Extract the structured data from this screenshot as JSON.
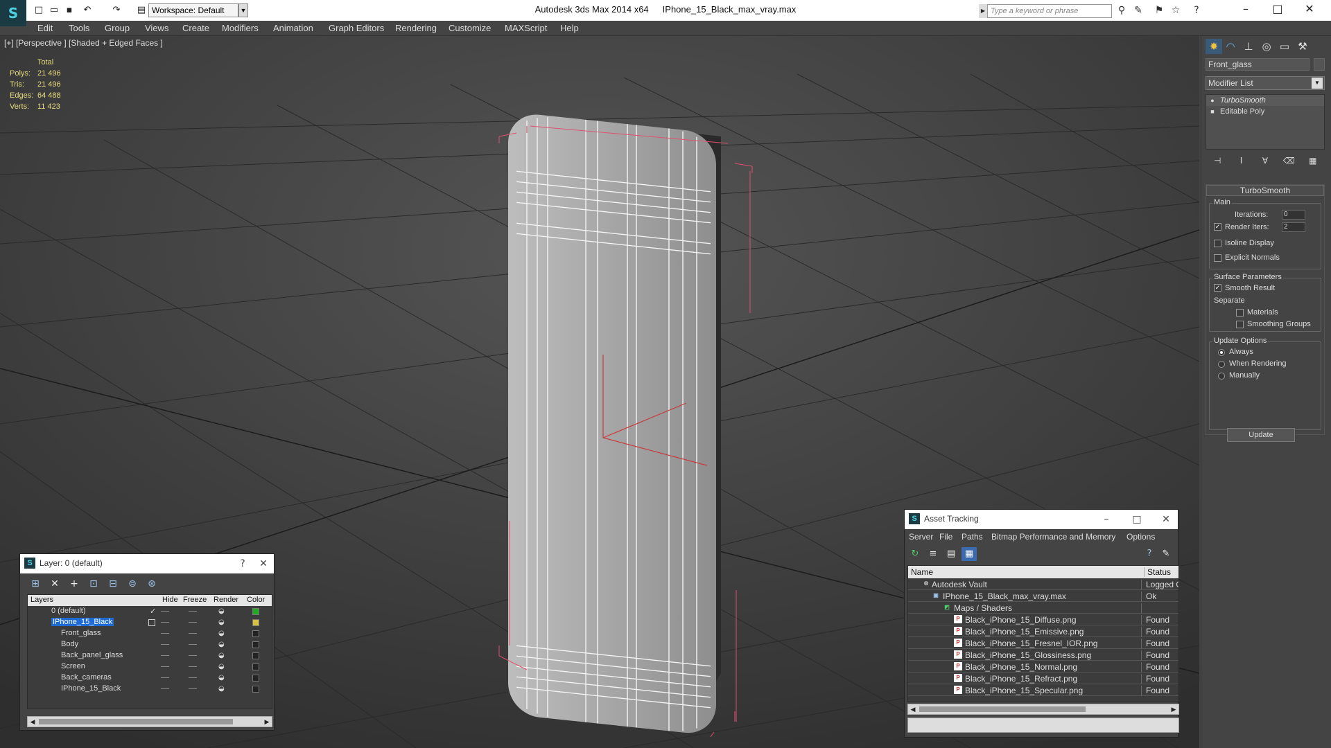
{
  "app": {
    "title": "Autodesk 3ds Max 2014 x64",
    "file": "IPhone_15_Black_max_vray.max",
    "workspace": "Workspace: Default",
    "search_placeholder": "Type a keyword or phrase"
  },
  "menu": [
    "Edit",
    "Tools",
    "Group",
    "Views",
    "Create",
    "Modifiers",
    "Animation",
    "Graph Editors",
    "Rendering",
    "Customize",
    "MAXScript",
    "Help"
  ],
  "viewport": {
    "label": "[+] [Perspective ] [Shaded + Edged Faces ]",
    "stats": {
      "header": "Total",
      "rows": [
        {
          "k": "Polys:",
          "v": "21 496"
        },
        {
          "k": "Tris:",
          "v": "21 496"
        },
        {
          "k": "Edges:",
          "v": "64 488"
        },
        {
          "k": "Verts:",
          "v": "11 423"
        }
      ]
    }
  },
  "command_panel": {
    "object_name": "Front_glass",
    "modifier_list": "Modifier List",
    "stack": [
      "TurboSmooth",
      "Editable Poly"
    ],
    "turbosmooth": {
      "title": "TurboSmooth",
      "main": "Main",
      "iterations_label": "Iterations:",
      "iterations": "0",
      "render_iters_label": "Render Iters:",
      "render_iters": "2",
      "render_iters_checked": true,
      "isoline": "Isoline Display",
      "isoline_checked": false,
      "explicit": "Explicit Normals",
      "explicit_checked": false,
      "surface_params": "Surface Parameters",
      "smooth_result": "Smooth Result",
      "smooth_result_checked": true,
      "separate": "Separate",
      "materials": "Materials",
      "smoothing_groups": "Smoothing Groups",
      "update_options": "Update Options",
      "always": "Always",
      "when_rendering": "When Rendering",
      "manually": "Manually",
      "update": "Update"
    }
  },
  "layer_panel": {
    "title": "Layer: 0 (default)",
    "help": "?",
    "columns": {
      "layers": "Layers",
      "hide": "Hide",
      "freeze": "Freeze",
      "render": "Render",
      "color": "Color"
    },
    "rows": [
      {
        "name": "0 (default)",
        "indent": 0,
        "color": "#22aa22",
        "selected": false
      },
      {
        "name": "IPhone_15_Black",
        "indent": 0,
        "color": "#d8c040",
        "selected": true
      },
      {
        "name": "Front_glass",
        "indent": 1,
        "color": "#222222",
        "selected": false
      },
      {
        "name": "Body",
        "indent": 1,
        "color": "#222222",
        "selected": false
      },
      {
        "name": "Back_panel_glass",
        "indent": 1,
        "color": "#222222",
        "selected": false
      },
      {
        "name": "Screen",
        "indent": 1,
        "color": "#222222",
        "selected": false
      },
      {
        "name": "Back_cameras",
        "indent": 1,
        "color": "#222222",
        "selected": false
      },
      {
        "name": "IPhone_15_Black",
        "indent": 1,
        "color": "#222222",
        "selected": false
      }
    ]
  },
  "asset_panel": {
    "title": "Asset Tracking",
    "menu": [
      "Server",
      "File",
      "Paths",
      "Bitmap Performance and Memory",
      "Options"
    ],
    "columns": {
      "name": "Name",
      "status": "Status"
    },
    "rows": [
      {
        "name": "Autodesk Vault",
        "status": "Logged O",
        "indent": 0,
        "icon": "vault-icon"
      },
      {
        "name": "IPhone_15_Black_max_vray.max",
        "status": "Ok",
        "indent": 1,
        "icon": "max-file-icon"
      },
      {
        "name": "Maps / Shaders",
        "status": "",
        "indent": 2,
        "icon": "maps-icon"
      },
      {
        "name": "Black_iPhone_15_Diffuse.png",
        "status": "Found",
        "indent": 3,
        "icon": "png-icon"
      },
      {
        "name": "Black_iPhone_15_Emissive.png",
        "status": "Found",
        "indent": 3,
        "icon": "png-icon"
      },
      {
        "name": "Black_iPhone_15_Fresnel_IOR.png",
        "status": "Found",
        "indent": 3,
        "icon": "png-icon"
      },
      {
        "name": "Black_iPhone_15_Glossiness.png",
        "status": "Found",
        "indent": 3,
        "icon": "png-icon"
      },
      {
        "name": "Black_iPhone_15_Normal.png",
        "status": "Found",
        "indent": 3,
        "icon": "png-icon"
      },
      {
        "name": "Black_iPhone_15_Refract.png",
        "status": "Found",
        "indent": 3,
        "icon": "png-icon"
      },
      {
        "name": "Black_iPhone_15_Specular.png",
        "status": "Found",
        "indent": 3,
        "icon": "png-icon"
      }
    ]
  }
}
